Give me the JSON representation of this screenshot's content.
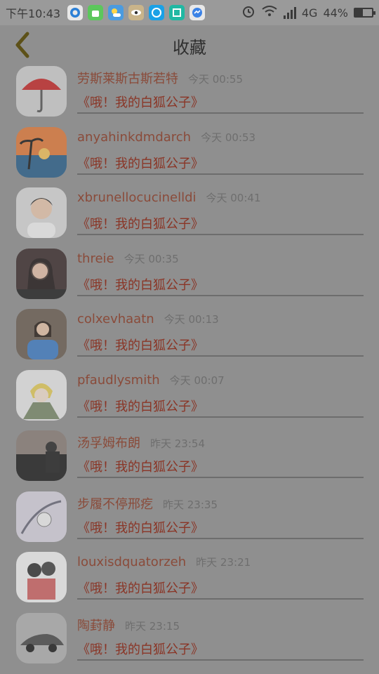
{
  "status_bar": {
    "time": "下午10:43",
    "network": "4G",
    "battery_percent": "44%",
    "battery_level": 0.44,
    "app_icons": [
      "browser-app-icon",
      "android-app-icon",
      "weather-app-icon",
      "eye-app-icon",
      "chat-app-icon",
      "scan-app-icon",
      "messenger-app-icon"
    ],
    "status_icons": [
      "alarm-icon",
      "wifi-icon",
      "signal-icon",
      "battery-icon"
    ]
  },
  "header": {
    "back_icon": "chevron-left-icon",
    "title": "收藏"
  },
  "items": [
    {
      "name": "劳斯莱斯古斯若特",
      "time": "今天 00:55",
      "message": "《哦！我的白狐公子》",
      "avatar": "red-umbrella"
    },
    {
      "name": "anyahinkdmdarch",
      "time": "今天 00:53",
      "message": "《哦！我的白狐公子》",
      "avatar": "beach-sunset"
    },
    {
      "name": "xbrunellocucinelldi",
      "time": "今天 00:41",
      "message": "《哦！我的白狐公子》",
      "avatar": "boy-portrait"
    },
    {
      "name": "threie",
      "time": "今天 00:35",
      "message": "《哦！我的白狐公子》",
      "avatar": "girl-photo"
    },
    {
      "name": "colxevhaatn",
      "time": "今天 00:13",
      "message": "《哦！我的白狐公子》",
      "avatar": "girl-blue"
    },
    {
      "name": "pfaudlysmith",
      "time": "今天 00:07",
      "message": "《哦！我的白狐公子》",
      "avatar": "anime-character"
    },
    {
      "name": "汤孚姆布朗",
      "time": "昨天 23:54",
      "message": "《哦！我的白狐公子》",
      "avatar": "dusk-silhouette"
    },
    {
      "name": "步履不停邢疙",
      "time": "昨天 23:35",
      "message": "《哦！我的白狐公子》",
      "avatar": "illustration"
    },
    {
      "name": "louxisdquatorzeh",
      "time": "昨天 23:21",
      "message": "《哦！我的白狐公子》",
      "avatar": "couple-sketch"
    },
    {
      "name": "陶葑静",
      "time": "昨天 23:15",
      "message": "《哦！我的白狐公子》",
      "avatar": "sports-car"
    }
  ]
}
